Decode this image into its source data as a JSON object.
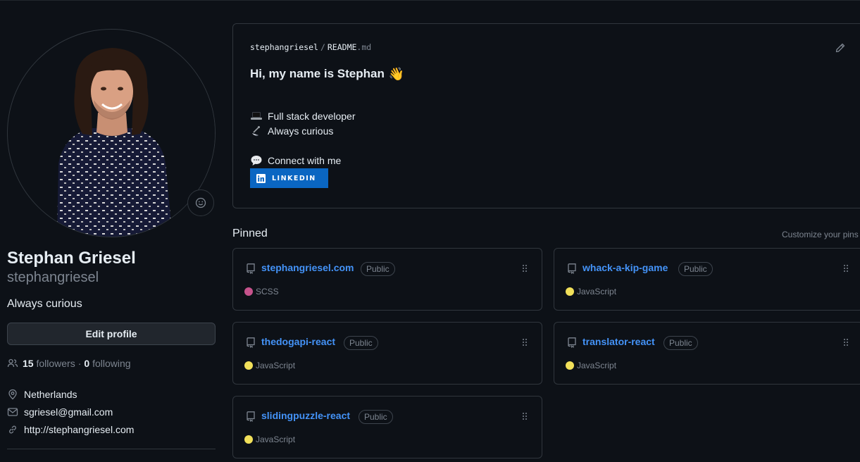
{
  "profile": {
    "name": "Stephan Griesel",
    "login": "stephangriesel",
    "bio": "Always curious",
    "edit_profile_label": "Edit profile",
    "followers_count": "15",
    "followers_label": "followers",
    "separator": "·",
    "following_count": "0",
    "following_label": "following",
    "location": "Netherlands",
    "email": "sgriesel@gmail.com",
    "website": "http://stephangriesel.com"
  },
  "readme": {
    "owner": "stephangriesel",
    "slash": "/",
    "file": "README",
    "ext": ".md",
    "heading": "Hi, my name is Stephan",
    "heading_emoji": "👋",
    "lines": [
      {
        "emoji": "laptop-icon",
        "text": "Full stack developer"
      },
      {
        "emoji": "satellite-icon",
        "text": "Always curious"
      },
      {
        "emoji": "speech-bubble-icon",
        "text": "Connect with me"
      }
    ],
    "linkedin_label": "LINKEDIN",
    "linkedin_color": "#0a66c2"
  },
  "pinned": {
    "title": "Pinned",
    "customize_label": "Customize your pins",
    "repos": [
      {
        "name": "stephangriesel.com",
        "visibility": "Public",
        "language": "SCSS",
        "lang_color": "#c6538c"
      },
      {
        "name": "whack-a-kip-game",
        "visibility": "Public",
        "language": "JavaScript",
        "lang_color": "#f1e05a"
      },
      {
        "name": "thedogapi-react",
        "visibility": "Public",
        "language": "JavaScript",
        "lang_color": "#f1e05a"
      },
      {
        "name": "translator-react",
        "visibility": "Public",
        "language": "JavaScript",
        "lang_color": "#f1e05a"
      },
      {
        "name": "slidingpuzzle-react",
        "visibility": "Public",
        "language": "JavaScript",
        "lang_color": "#f1e05a"
      }
    ]
  },
  "colors": {
    "background": "#0d1117",
    "border": "#30363d",
    "link": "#4493f8",
    "muted": "#7d8590"
  }
}
